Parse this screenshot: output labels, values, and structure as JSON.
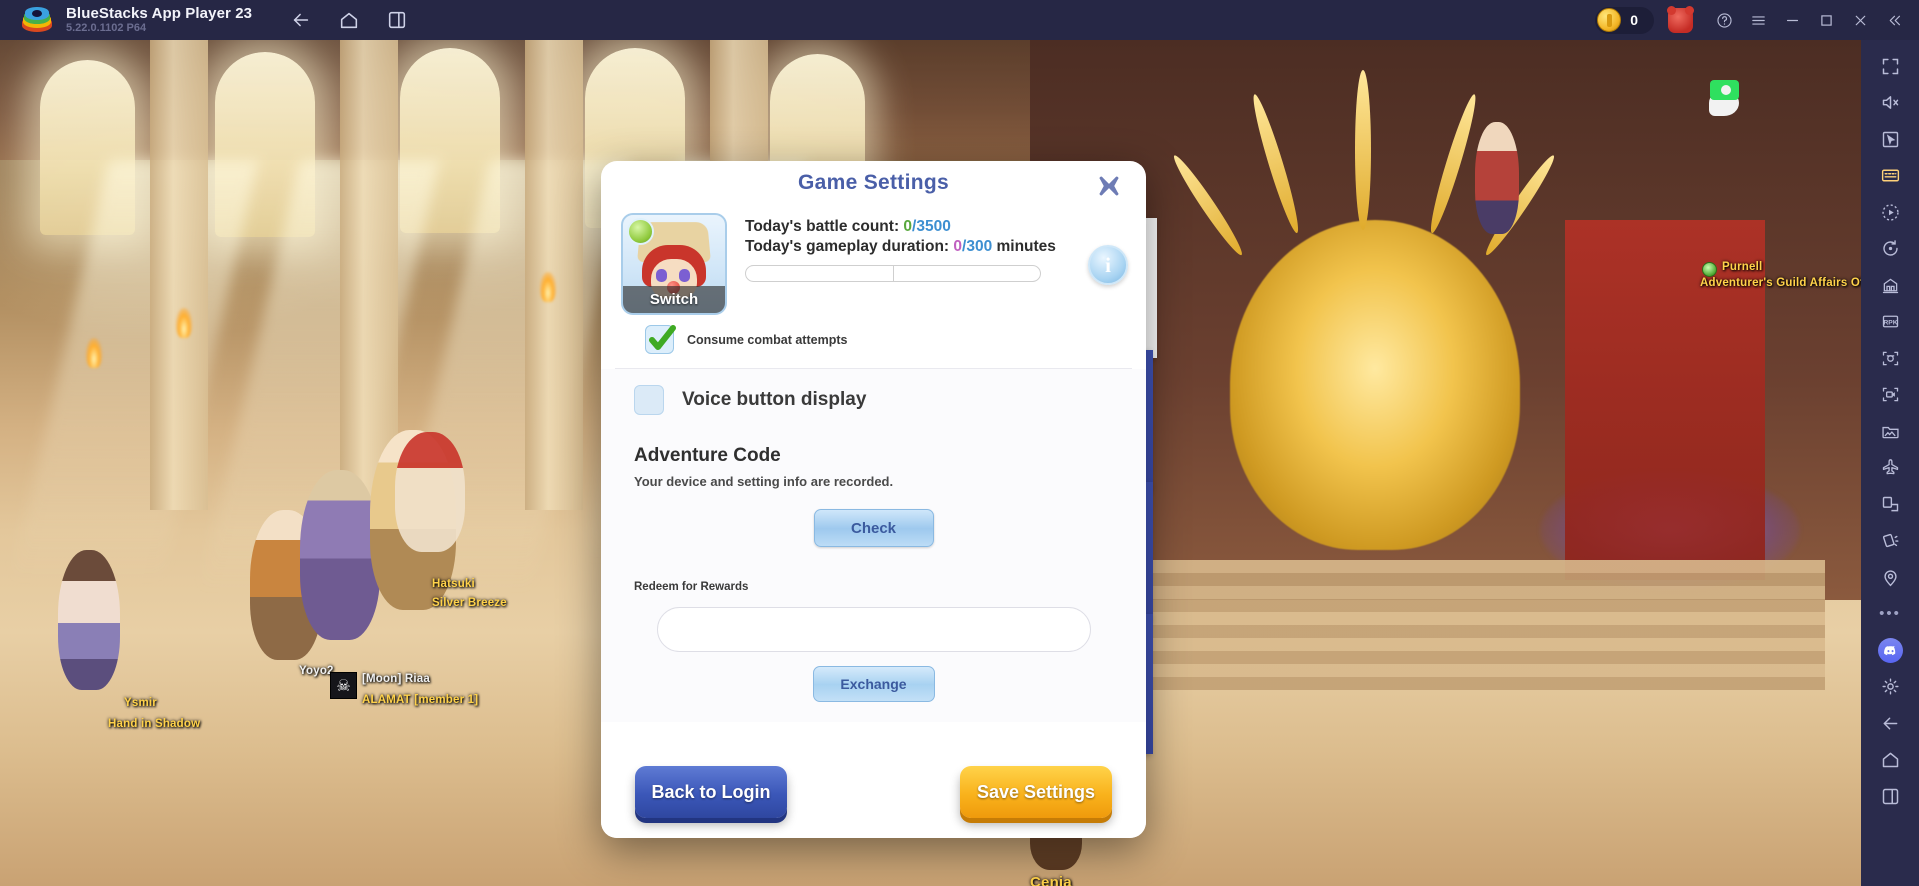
{
  "titlebar": {
    "app_name": "BlueStacks App Player 23",
    "version": "5.22.0.1102  P64",
    "logo_icon": "bluestacks-logo",
    "nav": [
      {
        "name": "back-icon",
        "label": "Back"
      },
      {
        "name": "home-icon",
        "label": "Home"
      },
      {
        "name": "multi-instance-icon",
        "label": "Multi-instance"
      }
    ],
    "coin_value": "0",
    "coin_icon": "coin-icon",
    "bear_icon": "bear-avatar-icon",
    "help_icon": "help-icon",
    "menu_icon": "hamburger-menu-icon",
    "minimize_icon": "minimize-icon",
    "maximize_icon": "maximize-icon",
    "close_icon": "close-icon",
    "collapse_icon": "collapse-chevrons-icon"
  },
  "modal": {
    "title": "Game Settings",
    "close_icon": "close-x-icon",
    "avatar": {
      "switch_label": "Switch",
      "badge_icon": "character-class-badge-icon"
    },
    "counters": {
      "battle_label": "Today's battle count: ",
      "battle_current": "0",
      "battle_max": "/3500",
      "duration_label": "Today's gameplay duration: ",
      "duration_current": "0",
      "duration_max": "/300",
      "duration_unit": "minutes",
      "info_glyph": "i",
      "info_icon": "info-icon",
      "bar1_percent": 0,
      "bar2_percent": 0
    },
    "consume": {
      "label": "Consume combat attempts",
      "checked": true,
      "icon": "green-checkmark-icon"
    },
    "voice": {
      "label": "Voice button display",
      "checked": false
    },
    "adventure": {
      "title": "Adventure Code",
      "subtitle": "Your device and setting info are recorded.",
      "check_button": "Check"
    },
    "redeem": {
      "label": "Redeem for Rewards",
      "input_value": "",
      "input_placeholder": "",
      "exchange_button": "Exchange"
    },
    "footer": {
      "back_button": "Back to Login",
      "save_button": "Save Settings"
    }
  },
  "game_tabs": [
    {
      "name": "tab-chat-translate-top",
      "icon": "chat-translate-icon",
      "active": true
    },
    {
      "name": "tab-image-settings",
      "icon": "image-settings-icon",
      "active": false
    },
    {
      "name": "tab-security-shield",
      "icon": "shield-check-icon",
      "active": false
    },
    {
      "name": "tab-chat-translate-bottom",
      "icon": "chat-translate-icon",
      "active": false
    }
  ],
  "game_world": {
    "screenshot_badge_icon": "screenshot-camera-bubble-icon",
    "npc": {
      "name": "Purnell",
      "title": "Adventurer's Guild Affairs Officer"
    },
    "players": [
      {
        "name": "Hatsuki",
        "guild": "Silver Breeze"
      },
      {
        "name": "Yoyo2",
        "guild": ""
      },
      {
        "name": "[Moon] Riaa",
        "guild": "ALAMAT [member 1]"
      },
      {
        "name": "Ysmir",
        "guild": "Hand in Shadow"
      },
      {
        "name": "Cenia",
        "guild": ""
      }
    ]
  },
  "sidebar": {
    "items": [
      {
        "name": "fullscreen-icon",
        "label": "Fullscreen"
      },
      {
        "name": "mute-icon",
        "label": "Mute"
      },
      {
        "name": "cursor-pointer-icon",
        "label": "Pointer"
      },
      {
        "name": "keyboard-controls-icon",
        "label": "Game controls",
        "highlight": true
      },
      {
        "name": "macro-record-icon",
        "label": "Macro"
      },
      {
        "name": "rotate-icon",
        "label": "Rotate"
      },
      {
        "name": "multi-instance-sync-icon",
        "label": "Multi-instance sync"
      },
      {
        "name": "real-time-translation-icon",
        "label": "Real-time translation"
      },
      {
        "name": "screenshot-icon",
        "label": "Screenshot"
      },
      {
        "name": "screen-record-icon",
        "label": "Record screen"
      },
      {
        "name": "media-manager-icon",
        "label": "Media manager"
      },
      {
        "name": "airplane-icon",
        "label": "Eco mode"
      },
      {
        "name": "install-apk-icon",
        "label": "Install APK"
      },
      {
        "name": "shake-icon",
        "label": "Shake"
      },
      {
        "name": "location-icon",
        "label": "Location"
      },
      {
        "name": "more-dots-icon",
        "label": "More"
      },
      {
        "name": "discord-icon",
        "label": "Discord"
      },
      {
        "name": "settings-gear-icon",
        "label": "Settings"
      },
      {
        "name": "back-icon",
        "label": "Back"
      },
      {
        "name": "home-icon",
        "label": "Home"
      },
      {
        "name": "recent-apps-icon",
        "label": "Recent apps"
      }
    ]
  }
}
